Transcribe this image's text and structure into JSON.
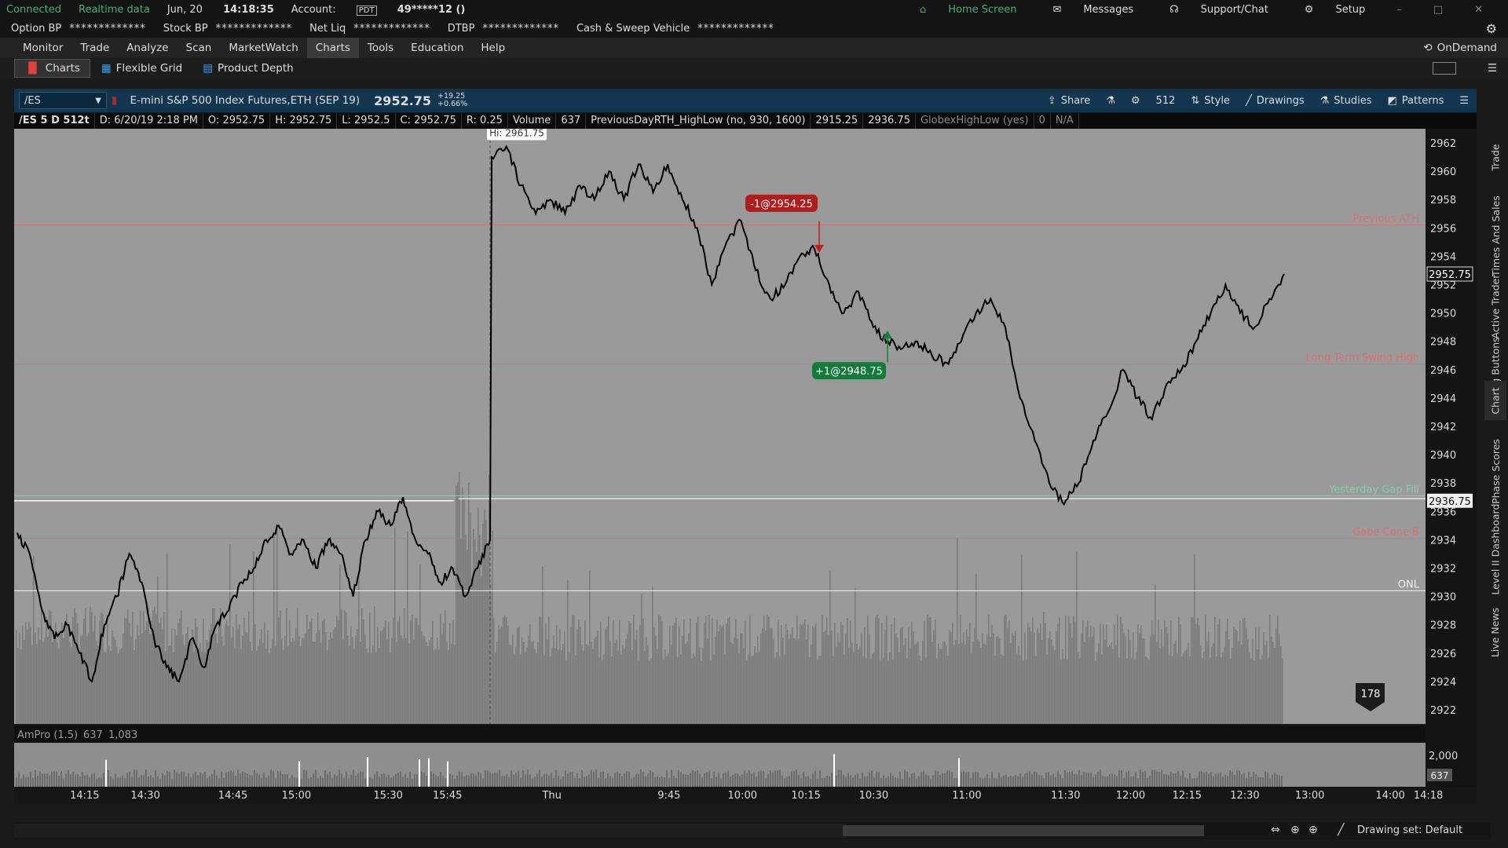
{
  "status": {
    "connected": "Connected",
    "realtime": "Realtime data",
    "date": "Jun, 20",
    "time": "14:18:35",
    "account_label": "Account:",
    "account_badge": "PDT",
    "account_value": "49*****12 ()",
    "home": "Home Screen",
    "messages": "Messages",
    "support": "Support/Chat",
    "setup": "Setup"
  },
  "bp": [
    {
      "label": "Option BP",
      "value": "*************"
    },
    {
      "label": "Stock BP",
      "value": "*************"
    },
    {
      "label": "Net Liq",
      "value": "*************"
    },
    {
      "label": "DTBP",
      "value": "*************"
    },
    {
      "label": "Cash & Sweep Vehicle",
      "value": "*************"
    }
  ],
  "menu": [
    "Monitor",
    "Trade",
    "Analyze",
    "Scan",
    "MarketWatch",
    "Charts",
    "Tools",
    "Education",
    "Help"
  ],
  "ondemand": "OnDemand",
  "subtabs": [
    "Charts",
    "Flexible Grid",
    "Product Depth"
  ],
  "header": {
    "symbol": "/ES",
    "description": "E-mini S&P 500 Index Futures,ETH (SEP 19)",
    "price": "2952.75",
    "change": "+19.25",
    "change_pct": "+0.66%",
    "share": "Share",
    "ticks": "512",
    "style": "Style",
    "drawings": "Drawings",
    "studies": "Studies",
    "patterns": "Patterns"
  },
  "info": [
    "/ES 5 D 512t",
    "D: 6/20/19 2:18 PM",
    "O: 2952.75",
    "H: 2952.75",
    "L: 2952.5",
    "C: 2952.75",
    "R: 0.25",
    "Volume",
    "637",
    "PreviousDayRTH_HighLow (no, 930, 1600)",
    "2915.25",
    "2936.75",
    "GlobexHighLow (yes)",
    "0",
    "N/A"
  ],
  "chart_data": {
    "type": "line",
    "title": "",
    "ylim": [
      2921,
      2963
    ],
    "y_ticks": [
      2922,
      2924,
      2926,
      2928,
      2930,
      2932,
      2934,
      2936,
      2938,
      2940,
      2942,
      2944,
      2946,
      2948,
      2950,
      2952,
      2954,
      2956,
      2958,
      2960,
      2962
    ],
    "x_ticks": [
      "14:15",
      "14:30",
      "14:45",
      "15:00",
      "15:30",
      "15:45",
      "Thu",
      "9:45",
      "10:00",
      "10:15",
      "10:30",
      "11:00",
      "11:30",
      "12:00",
      "12:15",
      "12:30",
      "13:00",
      "14:00",
      "14:18"
    ],
    "x_tick_pos": [
      0.05,
      0.093,
      0.155,
      0.2,
      0.265,
      0.307,
      0.381,
      0.464,
      0.516,
      0.561,
      0.609,
      0.675,
      0.745,
      0.791,
      0.831,
      0.872,
      0.918,
      0.975,
      1.002
    ],
    "series": [
      {
        "values": [
          2934.5,
          2933,
          2929,
          2927,
          2928,
          2926,
          2924,
          2928,
          2930,
          2933,
          2931,
          2927,
          2925,
          2924,
          2927,
          2925,
          2928,
          2929,
          2931,
          2932,
          2934,
          2935,
          2933,
          2934,
          2932,
          2934,
          2933,
          2930,
          2934,
          2936,
          2935,
          2937,
          2934,
          2933,
          2931,
          2932,
          2930,
          2932,
          2934,
          2961,
          2961.75,
          2959,
          2957,
          2958,
          2957,
          2959,
          2958,
          2960,
          2958,
          2960.5,
          2958.5,
          2960.5,
          2958,
          2956,
          2952,
          2955,
          2956.5,
          2953,
          2951,
          2952,
          2954,
          2954.5,
          2952,
          2950,
          2951.5,
          2949,
          2948,
          2947.5,
          2948,
          2947,
          2946.5,
          2948,
          2950,
          2951,
          2949,
          2944,
          2941,
          2938,
          2936.5,
          2938,
          2941,
          2943,
          2946,
          2944,
          2942.5,
          2945,
          2946,
          2948,
          2950,
          2952,
          2950,
          2949,
          2951,
          2952.75
        ]
      }
    ],
    "levels": [
      {
        "label": "Previous ATH",
        "value": 2956.2,
        "color": "#e06a6a"
      },
      {
        "label": "Long Term Swing High",
        "value": 2946.4,
        "color": "#e06a6a"
      },
      {
        "label": "Yesterday Gap Fill",
        "value": 2937.1,
        "color": "#7fd9b0"
      },
      {
        "label": "Gabe Cone B",
        "value": 2934.1,
        "color": "#e06a6a"
      },
      {
        "label": "ONL",
        "value": 2930.4,
        "color": "#ffffff"
      }
    ],
    "price_marker": "2952.75",
    "gap_marker": "2936.75",
    "hi_label": "Hi: 2961.75",
    "trades": [
      {
        "label": "-1@2954.25",
        "color": "#b01c1c"
      },
      {
        "label": "+1@2948.75",
        "color": "#127a3a"
      }
    ],
    "counter": "178",
    "volume_ticks": [
      "2,000",
      "637"
    ],
    "lower_study": [
      "AmPro (1.5)",
      "637",
      "1,083"
    ]
  },
  "sidebar_tabs": [
    "Trade",
    "Times And Sales",
    "Active Trader",
    "Big Buttons",
    "Chart",
    "Phase Scores",
    "Dashboard",
    "Level II",
    "Live News"
  ],
  "bottom": {
    "drawing_set": "Drawing set: Default"
  },
  "colors": {
    "bg": "#9a9a9a",
    "header": "#12364f",
    "green": "#3cb371"
  }
}
